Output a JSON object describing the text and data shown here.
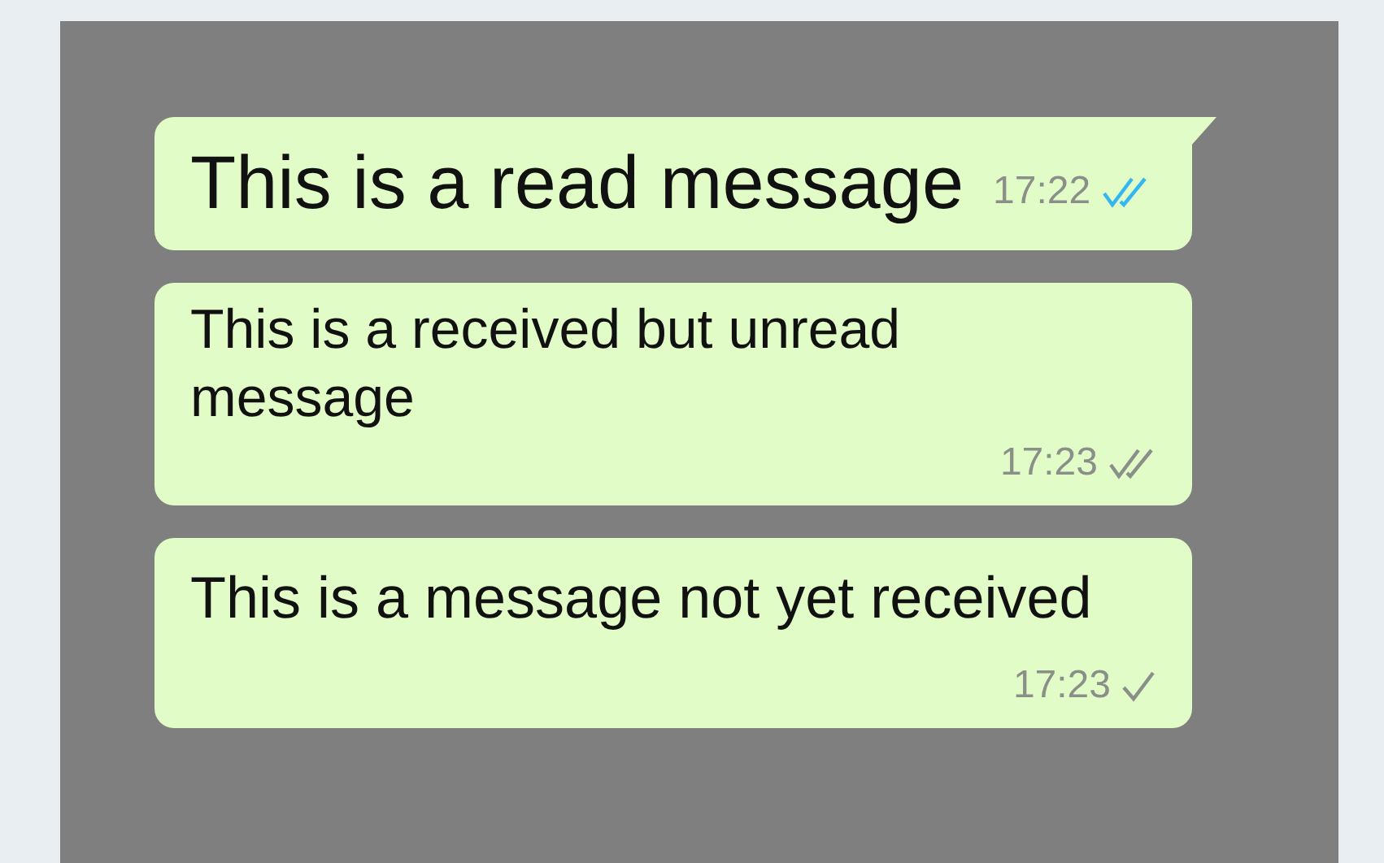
{
  "messages": [
    {
      "text": "This is a read message",
      "time": "17:22",
      "kind": "read",
      "tail": true
    },
    {
      "text": "This is a received but unread message",
      "time": "17:23",
      "kind": "delivered",
      "tail": false
    },
    {
      "text": "This is a message not yet received",
      "time": "17:23",
      "kind": "sent",
      "tail": false
    }
  ]
}
